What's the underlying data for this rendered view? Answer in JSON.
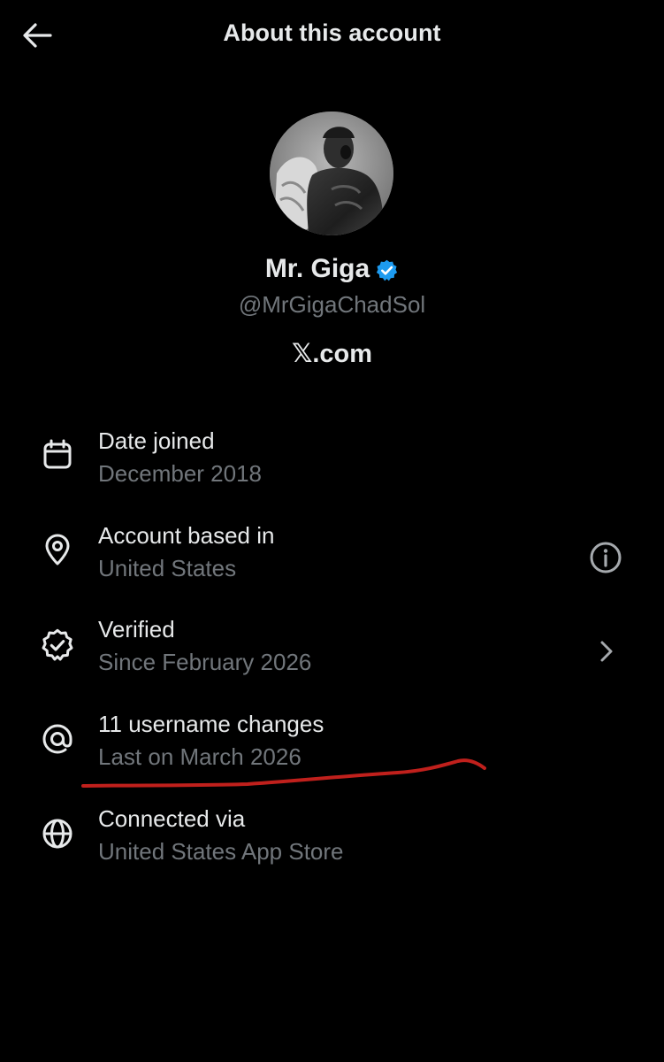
{
  "header": {
    "title": "About this account",
    "back_icon": "arrow-left-icon"
  },
  "profile": {
    "display_name": "Mr. Giga",
    "handle": "@MrGigaChadSol",
    "brand_text": "𝕏.com",
    "verified_badge": "verified-badge-icon",
    "verified_color": "#1d9bf0"
  },
  "details": [
    {
      "icon": "calendar-icon",
      "title": "Date joined",
      "subtitle": "December 2018",
      "action": ""
    },
    {
      "icon": "location-pin-icon",
      "title": "Account based in",
      "subtitle": "United States",
      "action": "info-icon"
    },
    {
      "icon": "verified-check-icon",
      "title": "Verified",
      "subtitle": "Since February 2026",
      "action": "chevron-right-icon"
    },
    {
      "icon": "at-sign-icon",
      "title": "11 username changes",
      "subtitle": "Last on March 2026",
      "action": ""
    },
    {
      "icon": "globe-icon",
      "title": "Connected via",
      "subtitle": "United States App Store",
      "action": ""
    }
  ],
  "colors": {
    "background": "#000000",
    "primary_text": "#e7e9ea",
    "secondary_text": "#71767b",
    "annotation": "#c0201c"
  }
}
